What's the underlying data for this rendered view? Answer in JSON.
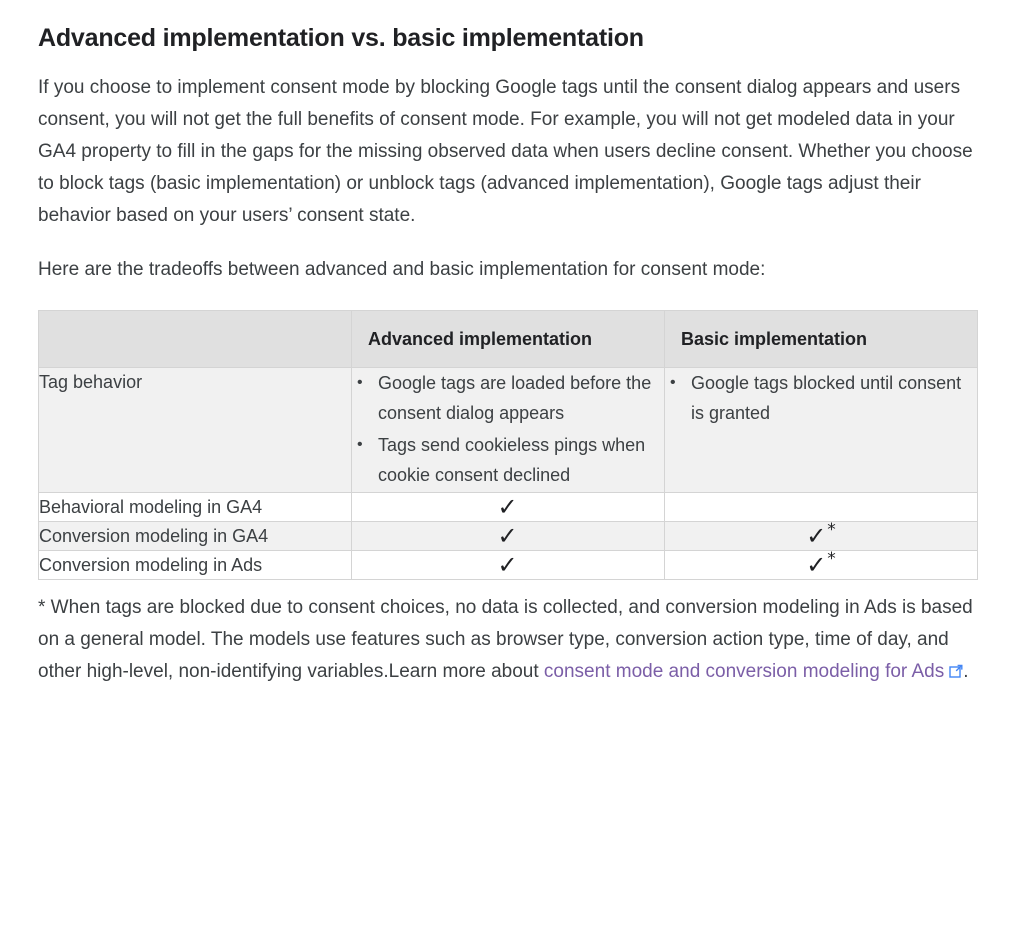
{
  "article": {
    "heading": "Advanced implementation vs. basic implementation",
    "paragraph_1": "If you choose to implement consent mode by blocking Google tags until the consent dialog appears and users consent, you will not get the full benefits of consent mode. For example, you will not get modeled data in your GA4 property to fill in the gaps for the missing observed data when users decline consent. Whether you choose to block tags (basic implementation) or unblock tags (advanced implementation), Google tags adjust their behavior based on your users’ consent state.",
    "lead_in": "Here are the tradeoffs between advanced and basic implementation for consent mode:"
  },
  "table": {
    "headers": {
      "col1": "",
      "col2": "Advanced implementation",
      "col3": "Basic implementation"
    },
    "rows": [
      {
        "label": "Tag behavior",
        "shaded": true,
        "advanced_bullets": [
          "Google tags are loaded before the consent dialog appears",
          "Tags send cookieless pings when cookie consent declined"
        ],
        "basic_bullets": [
          "Google tags blocked until consent is granted"
        ]
      },
      {
        "label": "Behavioral modeling in GA4",
        "shaded": false,
        "advanced_check": "✓",
        "advanced_star": "",
        "basic_check": "",
        "basic_star": ""
      },
      {
        "label": "Conversion modeling in GA4",
        "shaded": true,
        "advanced_check": "✓",
        "advanced_star": "",
        "basic_check": "✓",
        "basic_star": "*"
      },
      {
        "label": "Conversion modeling in Ads",
        "shaded": false,
        "advanced_check": "✓",
        "advanced_star": "",
        "basic_check": "✓",
        "basic_star": "*"
      }
    ]
  },
  "footnote": {
    "text": "* When tags are blocked due to consent choices, no data is collected, and conversion modeling in Ads is based on a general model. The models use features such as browser type, conversion action type, time of day, and other high-level, non-identifying variables.Learn more about ",
    "link_text": "consent mode and conversion modeling for Ads",
    "link_icon": "external-link-icon",
    "trailing": "."
  },
  "colors": {
    "link_purple": "#7b5ea7",
    "icon_blue": "#4285f4",
    "header_bg": "#e0e0e0",
    "row_shaded_bg": "#f1f1f1",
    "border": "#d4d4d4",
    "text": "#3c4043"
  }
}
